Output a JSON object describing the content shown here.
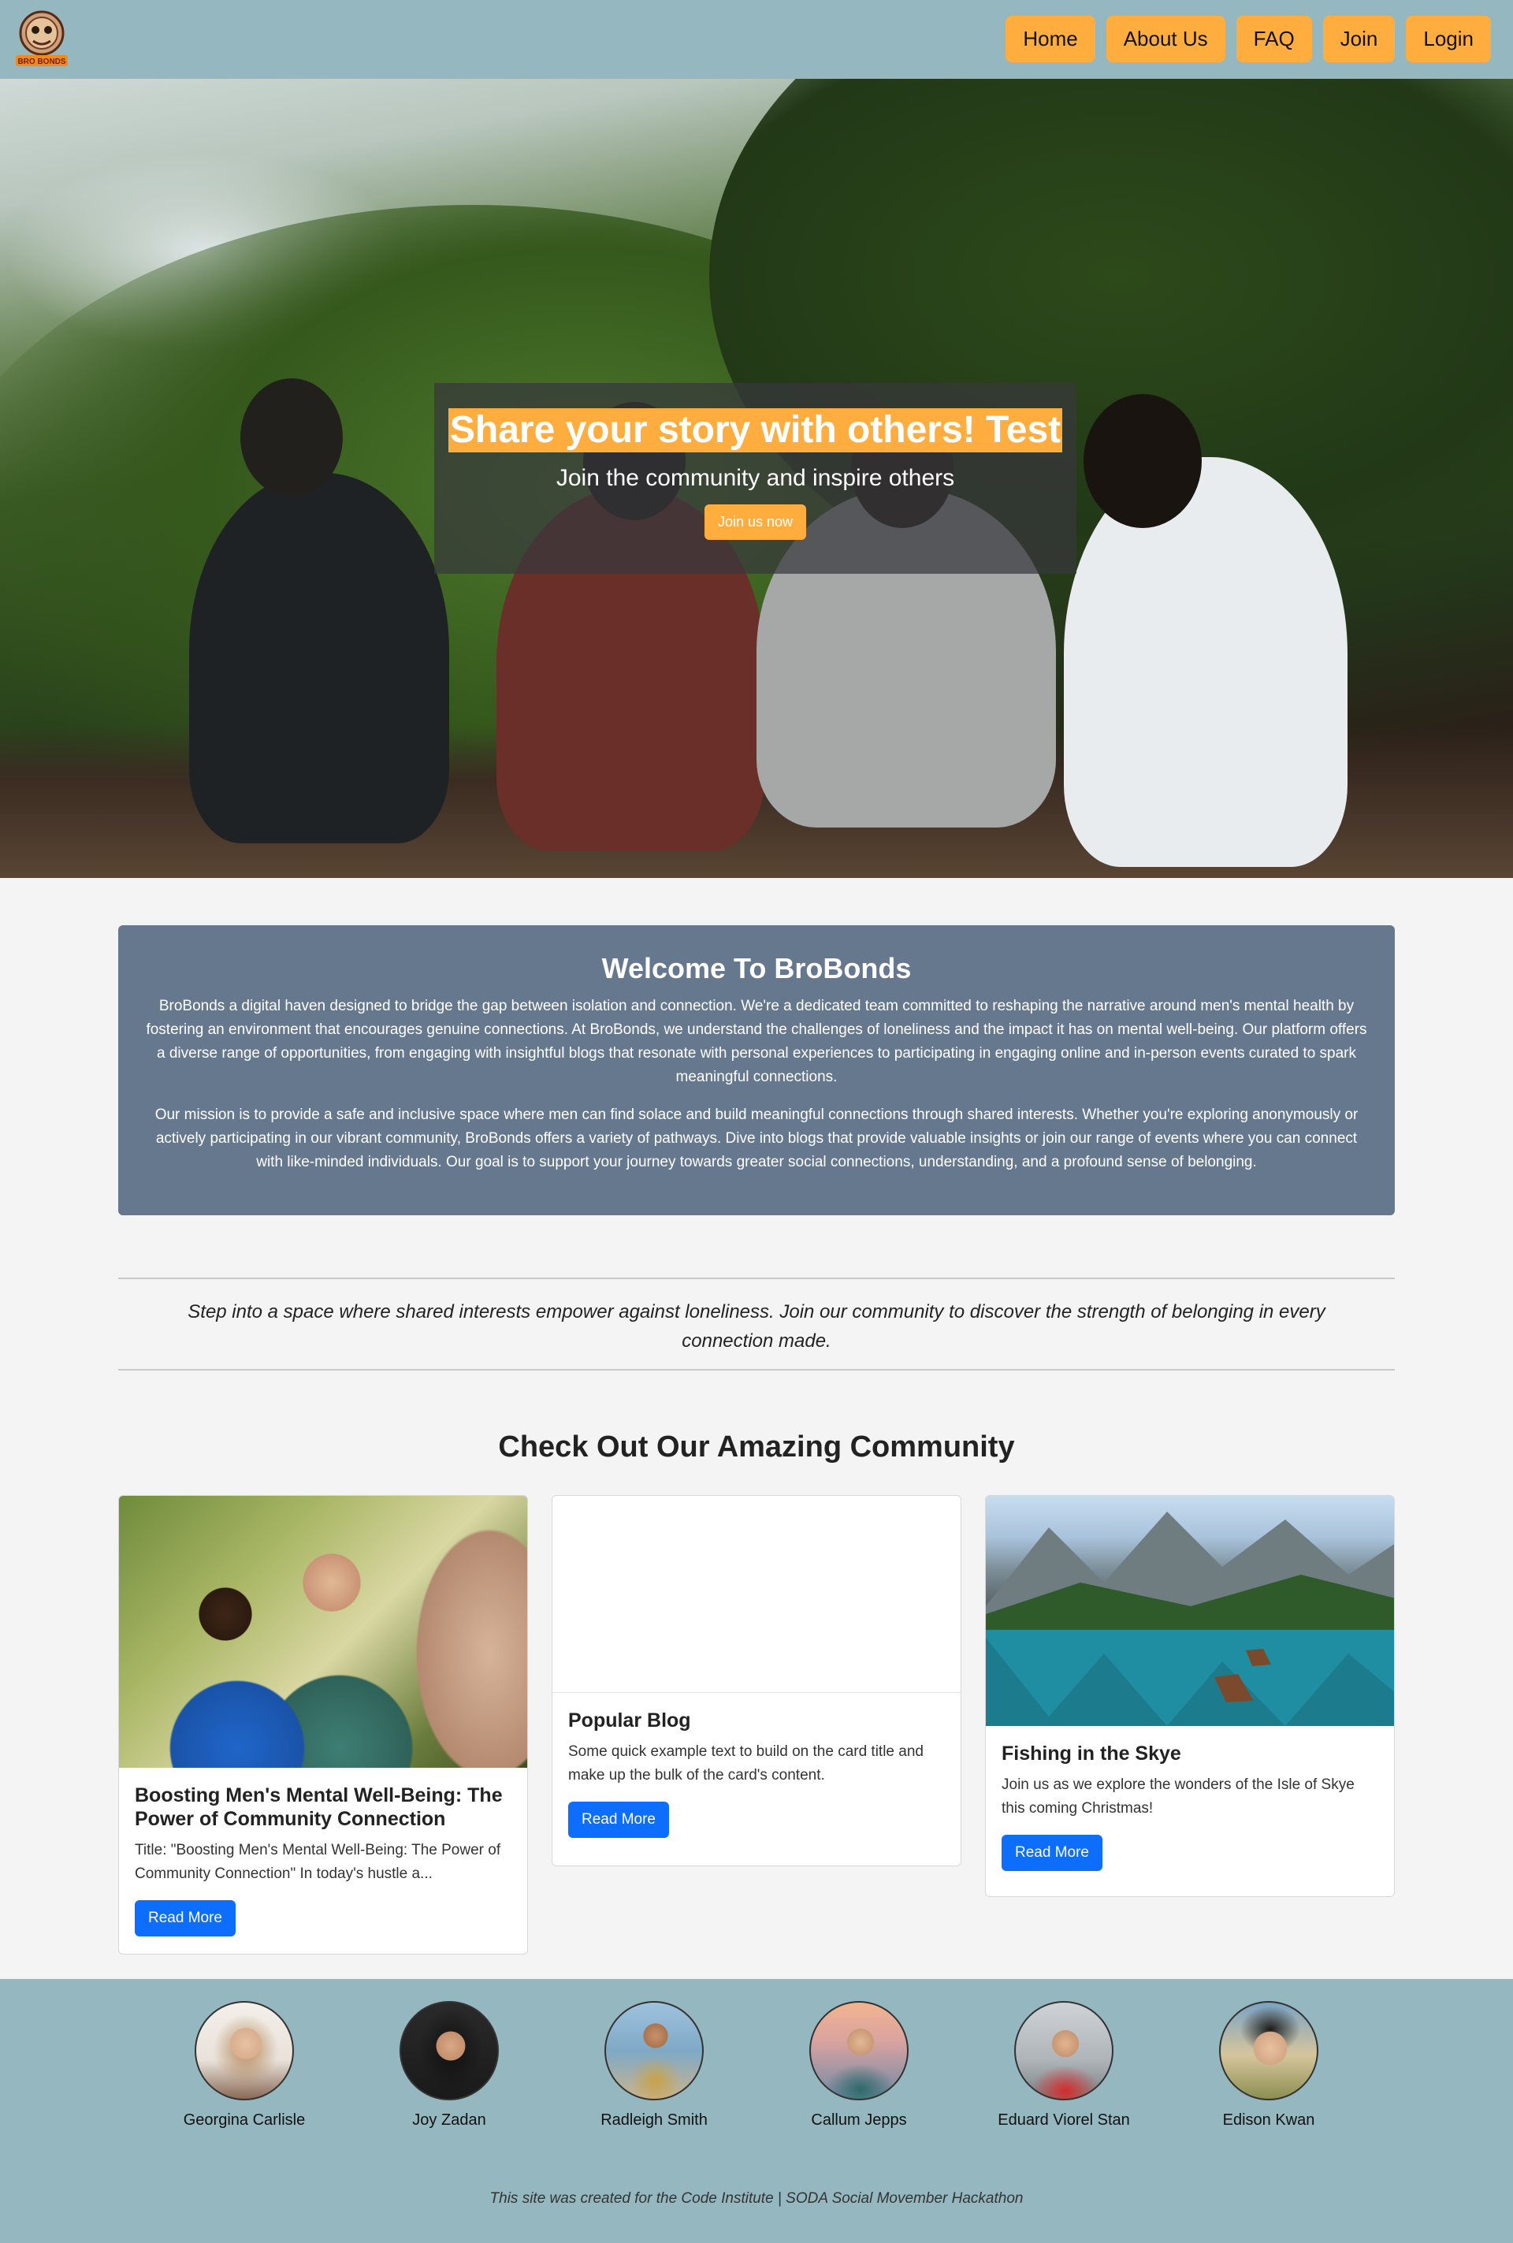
{
  "nav": {
    "logo_text": "BRO BONDS",
    "items": [
      {
        "label": "Home"
      },
      {
        "label": "About Us"
      },
      {
        "label": "FAQ"
      },
      {
        "label": "Join"
      },
      {
        "label": "Login"
      }
    ]
  },
  "hero": {
    "title": "Share your story with others! Test",
    "subtitle": "Join the community and inspire others",
    "button_label": "Join us now"
  },
  "welcome": {
    "heading": "Welcome To BroBonds",
    "paragraph1": "BroBonds a digital haven designed to bridge the gap between isolation and connection. We're a dedicated team committed to reshaping the narrative around men's mental health by fostering an environment that encourages genuine connections. At BroBonds, we understand the challenges of loneliness and the impact it has on mental well-being. Our platform offers a diverse range of opportunities, from engaging with insightful blogs that resonate with personal experiences to participating in engaging online and in-person events curated to spark meaningful connections.",
    "paragraph2": "Our mission is to provide a safe and inclusive space where men can find solace and build meaningful connections through shared interests. Whether you're exploring anonymously or actively participating in our vibrant community, BroBonds offers a variety of pathways. Dive into blogs that provide valuable insights or join our range of events where you can connect with like-minded individuals. Our goal is to support your journey towards greater social connections, understanding, and a profound sense of belonging."
  },
  "quote": "Step into a space where shared interests empower against loneliness. Join our community to discover the strength of belonging in every connection made.",
  "community": {
    "heading": "Check Out Our Amazing Community",
    "cards": [
      {
        "title": "Boosting Men's Mental Well-Being: The Power of Community Connection",
        "text": "Title: \"Boosting Men's Mental Well-Being: The Power of Community Connection\" In today's hustle a...",
        "button_label": "Read More"
      },
      {
        "title": "Popular Blog",
        "text": "Some quick example text to build on the card title and make up the bulk of the card's content.",
        "button_label": "Read More"
      },
      {
        "title": "Fishing in the Skye",
        "text": "Join us as we explore the wonders of the Isle of Skye this coming Christmas!",
        "button_label": "Read More"
      }
    ]
  },
  "footer": {
    "team": [
      {
        "name": "Georgina Carlisle"
      },
      {
        "name": "Joy Zadan"
      },
      {
        "name": "Radleigh Smith"
      },
      {
        "name": "Callum Jepps"
      },
      {
        "name": "Eduard Viorel Stan"
      },
      {
        "name": "Edison Kwan"
      }
    ],
    "credit": "This site was created for the Code Institute | SODA Social Movember Hackathon"
  },
  "colors": {
    "nav_bg": "#95b7bf",
    "accent": "#ffad3f",
    "welcome_bg": "#66788e",
    "primary_button": "#0d6efd"
  }
}
